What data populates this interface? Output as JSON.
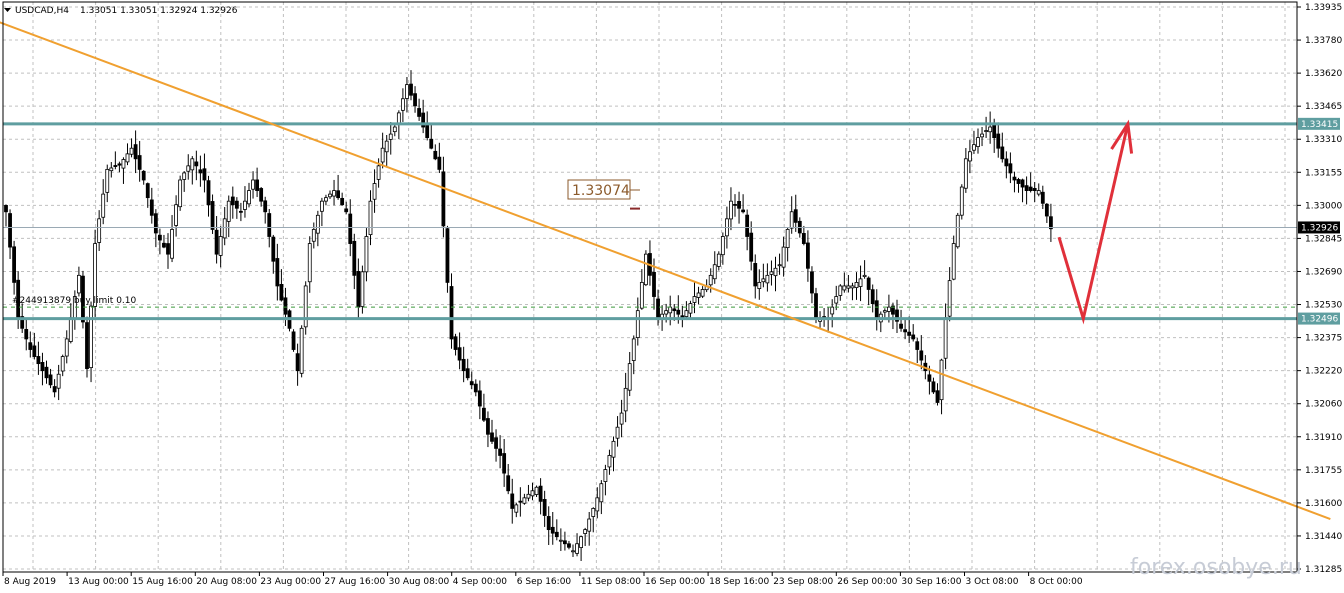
{
  "header": {
    "symbol_text": "USDCAD,H4",
    "ohlc_text": "1.33051 1.33051 1.32924 1.32926"
  },
  "watermark": "forex.osobye.ru",
  "price_label_box": "1.33074",
  "order_label": "#244913879 buy limit 0.10",
  "colors": {
    "background": "#ffffff",
    "grid": "#c0c0c0",
    "candle": "#000000",
    "level_line": "#5f9ea0",
    "trendline": "#f0a030",
    "forecast_arrow": "#e0303a",
    "price_tag": "#5f9ea0",
    "current_tag": "#000000"
  },
  "chart_data": {
    "type": "candlestick",
    "symbol": "USDCAD",
    "timeframe": "H4",
    "ylim": [
      1.313,
      1.3399
    ],
    "y_ticks": [
      "1.33935",
      "1.33780",
      "1.33620",
      "1.33465",
      "1.33310",
      "1.33155",
      "1.33000",
      "1.32845",
      "1.32690",
      "1.32530",
      "1.32375",
      "1.32220",
      "1.32060",
      "1.31910",
      "1.31755",
      "1.31600",
      "1.31440",
      "1.31285"
    ],
    "x_ticks": [
      "8 Aug 2019",
      "13 Aug 00:00",
      "15 Aug 16:00",
      "20 Aug 08:00",
      "23 Aug 00:00",
      "27 Aug 16:00",
      "30 Aug 08:00",
      "4 Sep 00:00",
      "6 Sep 16:00",
      "11 Sep 08:00",
      "16 Sep 00:00",
      "18 Sep 16:00",
      "23 Sep 08:00",
      "26 Sep 00:00",
      "30 Sep 16:00",
      "3 Oct 08:00",
      "8 Oct 00:00"
    ],
    "close_path": [
      [
        0,
        1.33
      ],
      [
        3,
        1.325
      ],
      [
        6,
        1.3235
      ],
      [
        9,
        1.3225
      ],
      [
        12,
        1.3215
      ],
      [
        15,
        1.324
      ],
      [
        18,
        1.327
      ],
      [
        20,
        1.3226
      ],
      [
        22,
        1.3285
      ],
      [
        25,
        1.332
      ],
      [
        28,
        1.3322
      ],
      [
        31,
        1.333
      ],
      [
        34,
        1.3315
      ],
      [
        37,
        1.329
      ],
      [
        40,
        1.328
      ],
      [
        43,
        1.3315
      ],
      [
        46,
        1.3325
      ],
      [
        49,
        1.3315
      ],
      [
        52,
        1.328
      ],
      [
        55,
        1.3305
      ],
      [
        58,
        1.33
      ],
      [
        61,
        1.3315
      ],
      [
        64,
        1.33
      ],
      [
        67,
        1.3265
      ],
      [
        70,
        1.3245
      ],
      [
        72,
        1.3225
      ],
      [
        75,
        1.3285
      ],
      [
        78,
        1.3305
      ],
      [
        81,
        1.331
      ],
      [
        84,
        1.33
      ],
      [
        87,
        1.3255
      ],
      [
        90,
        1.3305
      ],
      [
        93,
        1.333
      ],
      [
        96,
        1.334
      ],
      [
        99,
        1.336
      ],
      [
        102,
        1.3345
      ],
      [
        105,
        1.333
      ],
      [
        107,
        1.332
      ],
      [
        110,
        1.324
      ],
      [
        113,
        1.3225
      ],
      [
        116,
        1.3215
      ],
      [
        119,
        1.3195
      ],
      [
        122,
        1.3185
      ],
      [
        125,
        1.316
      ],
      [
        128,
        1.3165
      ],
      [
        131,
        1.317
      ],
      [
        134,
        1.315
      ],
      [
        137,
        1.3145
      ],
      [
        140,
        1.314
      ],
      [
        143,
        1.315
      ],
      [
        146,
        1.3165
      ],
      [
        149,
        1.3185
      ],
      [
        152,
        1.3205
      ],
      [
        155,
        1.324
      ],
      [
        158,
        1.328
      ],
      [
        161,
        1.325
      ],
      [
        164,
        1.3255
      ],
      [
        167,
        1.325
      ],
      [
        170,
        1.326
      ],
      [
        173,
        1.3265
      ],
      [
        176,
        1.328
      ],
      [
        179,
        1.3305
      ],
      [
        182,
        1.33
      ],
      [
        185,
        1.3265
      ],
      [
        188,
        1.327
      ],
      [
        191,
        1.3275
      ],
      [
        194,
        1.33
      ],
      [
        197,
        1.3285
      ],
      [
        200,
        1.325
      ],
      [
        203,
        1.325
      ],
      [
        206,
        1.3265
      ],
      [
        209,
        1.3265
      ],
      [
        212,
        1.327
      ],
      [
        215,
        1.325
      ],
      [
        218,
        1.3255
      ],
      [
        221,
        1.3245
      ],
      [
        224,
        1.324
      ],
      [
        227,
        1.3225
      ],
      [
        230,
        1.321
      ],
      [
        232,
        1.325
      ],
      [
        234,
        1.3285
      ],
      [
        237,
        1.3325
      ],
      [
        240,
        1.3335
      ],
      [
        243,
        1.334
      ],
      [
        246,
        1.3325
      ],
      [
        249,
        1.3315
      ],
      [
        252,
        1.331
      ],
      [
        255,
        1.331
      ],
      [
        258,
        1.3292
      ]
    ],
    "horizontal_levels": [
      {
        "price": 1.33415,
        "label": "1.33415"
      },
      {
        "price": 1.32496,
        "label": "1.32496"
      }
    ],
    "current_price": {
      "price": 1.32926,
      "label": "1.32926"
    },
    "order_line": {
      "price": 1.3255
    },
    "trendline": {
      "from": [
        -15,
        1.3399
      ],
      "to": [
        327,
        1.3155
      ]
    },
    "forecast_arrow": {
      "points": [
        [
          260,
          1.3288
        ],
        [
          266,
          1.32496
        ],
        [
          277,
          1.33415
        ]
      ]
    }
  }
}
